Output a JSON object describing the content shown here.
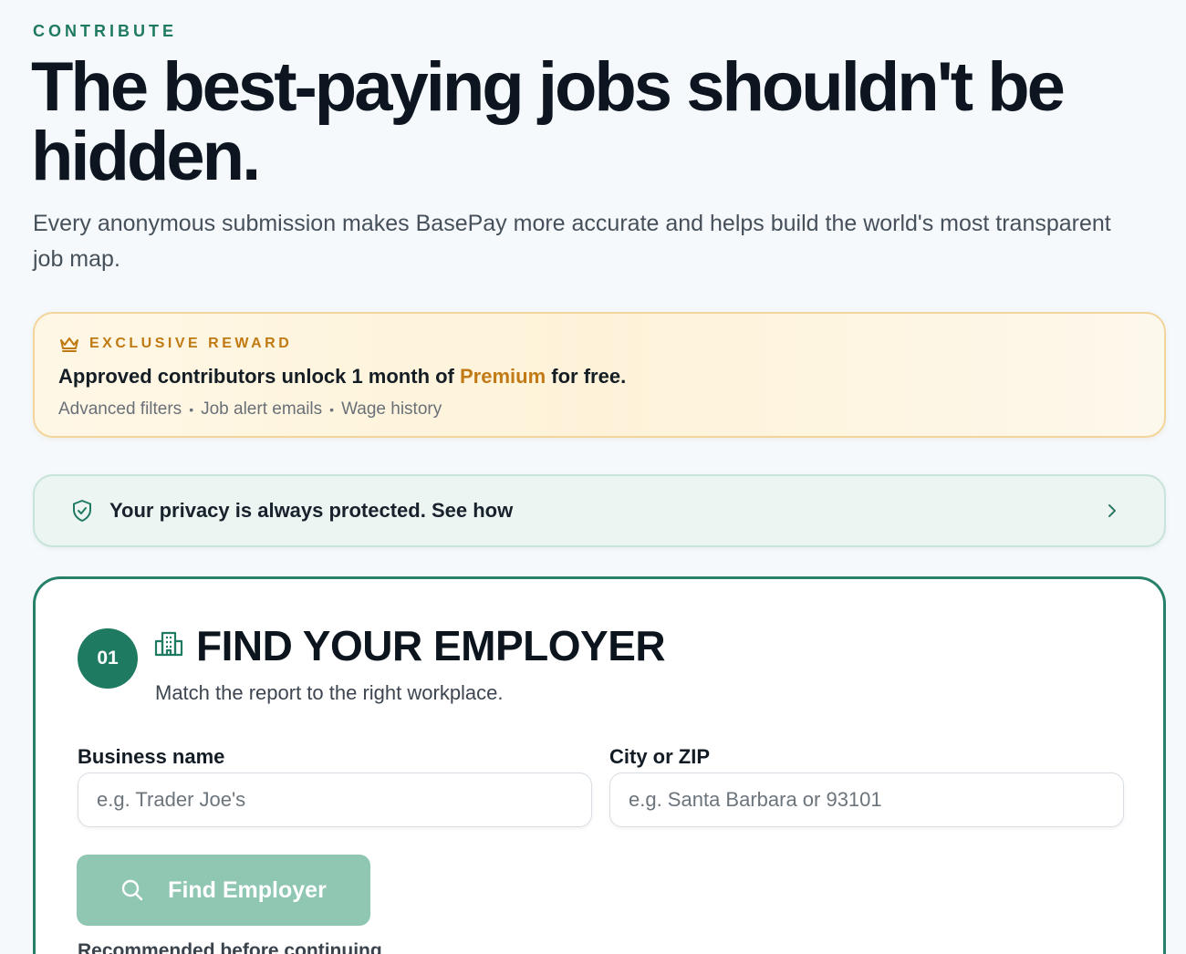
{
  "eyebrow": "CONTRIBUTE",
  "headline": "The best-paying jobs shouldn't be hidden.",
  "subhead": "Every anonymous submission makes BasePay more accurate and helps build the world's most transparent job map.",
  "reward": {
    "icon": "crown-icon",
    "tag": "EXCLUSIVE REWARD",
    "main_prefix": "Approved contributors unlock 1 month of ",
    "main_highlight": "Premium",
    "main_suffix": " for free.",
    "features": [
      "Advanced filters",
      "Job alert emails",
      "Wage history"
    ],
    "separator": "•"
  },
  "privacy": {
    "icon": "shield-check-icon",
    "text": "Your privacy is always protected. See how",
    "chevron": "chevron-right-icon"
  },
  "step": {
    "number": "01",
    "icon": "building-icon",
    "title": "FIND YOUR EMPLOYER",
    "subtitle": "Match the report to the right workplace."
  },
  "form": {
    "business_label": "Business name",
    "business_placeholder": "e.g. Trader Joe's",
    "business_value": "",
    "city_label": "City or ZIP",
    "city_placeholder": "e.g. Santa Barbara or 93101",
    "city_value": "",
    "find_button": "Find Employer",
    "find_icon": "search-icon",
    "recommend_note": "Recommended before continuing"
  },
  "colors": {
    "brand_green": "#1f7a62",
    "button_disabled": "#8fc7b3",
    "reward_accent": "#c07a12",
    "background": "#f5f9fc"
  }
}
